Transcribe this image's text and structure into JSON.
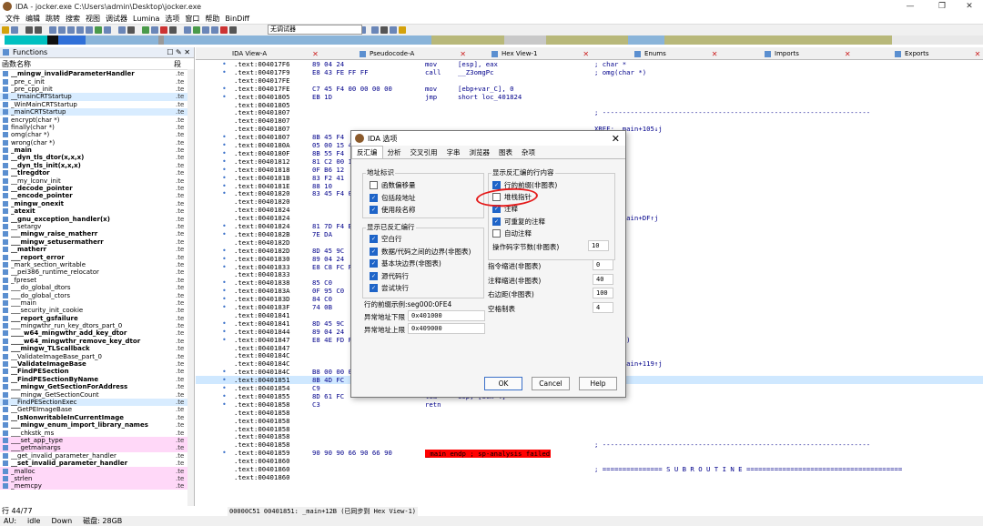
{
  "window": {
    "title": "IDA - jocker.exe C:\\Users\\admin\\Desktop\\jocker.exe",
    "controls": [
      "—",
      "❐",
      "✕"
    ]
  },
  "menu": [
    "文件",
    "编辑",
    "跳转",
    "搜索",
    "视图",
    "调试器",
    "Lumina",
    "选项",
    "窗口",
    "帮助",
    "BinDiff"
  ],
  "toolbar": {
    "debugger_select": "无调试器"
  },
  "functions_panel": {
    "title": "Functions",
    "col_name": "函数名称",
    "col_seg": "段",
    "items": [
      {
        "name": "__mingw_invalidParameterHandler",
        "seg": ".te",
        "style": "bold"
      },
      {
        "name": "_pre_c_init",
        "seg": ".te",
        "style": "normal"
      },
      {
        "name": "_pre_cpp_init",
        "seg": ".te",
        "style": "normal"
      },
      {
        "name": "__tmainCRTStartup",
        "seg": ".te",
        "style": "lib"
      },
      {
        "name": "_WinMainCRTStartup",
        "seg": ".te",
        "style": "normal"
      },
      {
        "name": "_mainCRTStartup",
        "seg": ".te",
        "style": "lib"
      },
      {
        "name": "encrypt(char *)",
        "seg": ".te",
        "style": "normal"
      },
      {
        "name": "finally(char *)",
        "seg": ".te",
        "style": "normal"
      },
      {
        "name": "omg(char *)",
        "seg": ".te",
        "style": "normal"
      },
      {
        "name": "wrong(char *)",
        "seg": ".te",
        "style": "normal"
      },
      {
        "name": "_main",
        "seg": ".te",
        "style": "bold"
      },
      {
        "name": "__dyn_tls_dtor(x,x,x)",
        "seg": ".te",
        "style": "bold"
      },
      {
        "name": "__dyn_tls_init(x,x,x)",
        "seg": ".te",
        "style": "bold"
      },
      {
        "name": "__tlregdtor",
        "seg": ".te",
        "style": "bold"
      },
      {
        "name": "__my_lconv_init",
        "seg": ".te",
        "style": "normal"
      },
      {
        "name": "__decode_pointer",
        "seg": ".te",
        "style": "bold"
      },
      {
        "name": "__encode_pointer",
        "seg": ".te",
        "style": "bold"
      },
      {
        "name": "_mingw_onexit",
        "seg": ".te",
        "style": "bold"
      },
      {
        "name": "_atexit",
        "seg": ".te",
        "style": "bold"
      },
      {
        "name": "__gnu_exception_handler(x)",
        "seg": ".te",
        "style": "bold"
      },
      {
        "name": "__setargv",
        "seg": ".te",
        "style": "normal"
      },
      {
        "name": "___mingw_raise_matherr",
        "seg": ".te",
        "style": "bold"
      },
      {
        "name": "___mingw_setusermatherr",
        "seg": ".te",
        "style": "bold"
      },
      {
        "name": "__matherr",
        "seg": ".te",
        "style": "bold"
      },
      {
        "name": "___report_error",
        "seg": ".te",
        "style": "bold"
      },
      {
        "name": "_mark_section_writable",
        "seg": ".te",
        "style": "normal"
      },
      {
        "name": "__pei386_runtime_relocator",
        "seg": ".te",
        "style": "normal"
      },
      {
        "name": "_fpreset",
        "seg": ".te",
        "style": "normal"
      },
      {
        "name": "___do_global_dtors",
        "seg": ".te",
        "style": "normal"
      },
      {
        "name": "___do_global_ctors",
        "seg": ".te",
        "style": "normal"
      },
      {
        "name": "___main",
        "seg": ".te",
        "style": "normal"
      },
      {
        "name": "___security_init_cookie",
        "seg": ".te",
        "style": "normal"
      },
      {
        "name": "___report_gsfailure",
        "seg": ".te",
        "style": "bold"
      },
      {
        "name": "___mingwthr_run_key_dtors_part_0",
        "seg": ".te",
        "style": "normal"
      },
      {
        "name": "____w64_mingwthr_add_key_dtor",
        "seg": ".te",
        "style": "bold"
      },
      {
        "name": "____w64_mingwthr_remove_key_dtor",
        "seg": ".te",
        "style": "bold"
      },
      {
        "name": "___mingw_TLScallback",
        "seg": ".te",
        "style": "bold"
      },
      {
        "name": "__ValidateImageBase_part_0",
        "seg": ".te",
        "style": "normal"
      },
      {
        "name": "__ValidateImageBase",
        "seg": ".te",
        "style": "bold"
      },
      {
        "name": "__FindPESection",
        "seg": ".te",
        "style": "bold"
      },
      {
        "name": "__FindPESectionByName",
        "seg": ".te",
        "style": "bold"
      },
      {
        "name": "___mingw_GetSectionForAddress",
        "seg": ".te",
        "style": "bold"
      },
      {
        "name": "___mingw_GetSectionCount",
        "seg": ".te",
        "style": "normal"
      },
      {
        "name": "__FindPESectionExec",
        "seg": ".te",
        "style": "lib"
      },
      {
        "name": "__GetPEImageBase",
        "seg": ".te",
        "style": "normal"
      },
      {
        "name": "__IsNonwritableInCurrentImage",
        "seg": ".te",
        "style": "bold"
      },
      {
        "name": "___mingw_enum_import_library_names",
        "seg": ".te",
        "style": "bold"
      },
      {
        "name": "___chkstk_ms",
        "seg": ".te",
        "style": "normal"
      },
      {
        "name": "___set_app_type",
        "seg": ".te",
        "style": "pink"
      },
      {
        "name": "___getmainargs",
        "seg": ".te",
        "style": "pink"
      },
      {
        "name": "__get_invalid_parameter_handler",
        "seg": ".te",
        "style": "normal"
      },
      {
        "name": "__set_invalid_parameter_handler",
        "seg": ".te",
        "style": "bold"
      },
      {
        "name": "_malloc",
        "seg": ".te",
        "style": "pink"
      },
      {
        "name": "_strlen",
        "seg": ".te",
        "style": "pink"
      },
      {
        "name": "_memcpy",
        "seg": ".te",
        "style": "pink"
      }
    ],
    "row_status": "行 44/77"
  },
  "tabs": [
    {
      "label": "IDA View-A"
    },
    {
      "label": "Pseudocode-A"
    },
    {
      "label": "Hex View-1"
    },
    {
      "label": "Enums"
    },
    {
      "label": "Imports"
    },
    {
      "label": "Exports"
    }
  ],
  "disasm": [
    {
      "dot": "•",
      "addr": ".text:004017F6",
      "bytes": "89 04 24",
      "mn": "mov",
      "op": "[esp], eax",
      "cmt": "; char *"
    },
    {
      "dot": "•",
      "addr": ".text:004017F9",
      "bytes": "E8 43 FE FF FF",
      "mn": "call",
      "op": "__Z3omgPc",
      "cmt": "; omg(char *)"
    },
    {
      "dot": "",
      "addr": ".text:004017FE",
      "bytes": "",
      "mn": "",
      "op": "",
      "cmt": ""
    },
    {
      "dot": "•",
      "addr": ".text:004017FE",
      "bytes": "C7 45 F4 00 00 00 00",
      "mn": "mov",
      "op": "[ebp+var_C], 0",
      "cmt": ""
    },
    {
      "dot": "•",
      "addr": ".text:00401805",
      "bytes": "EB 1D",
      "mn": "jmp",
      "op": "short loc_401824",
      "cmt": ""
    },
    {
      "dot": "",
      "addr": ".text:00401805",
      "bytes": "",
      "mn": "",
      "op": "",
      "cmt": ""
    },
    {
      "dot": "",
      "addr": ".text:00401807",
      "bytes": "",
      "mn": "",
      "op": "",
      "cmt": "; -------------------------------------------------------------------"
    },
    {
      "dot": "",
      "addr": ".text:00401807",
      "bytes": "",
      "mn": "",
      "op": "",
      "cmt": ""
    },
    {
      "dot": "",
      "addr": ".text:00401807",
      "bytes": "",
      "mn": "",
      "op": "",
      "cmt": "XREF: _main+105↓j"
    },
    {
      "dot": "•",
      "addr": ".text:00401807",
      "bytes": "8B 45 F4",
      "mn": "",
      "op": "",
      "cmt": ""
    },
    {
      "dot": "•",
      "addr": ".text:0040180A",
      "bytes": "05 00 15 40 00",
      "mn": "",
      "op": "",
      "cmt": "(char *)"
    },
    {
      "dot": "•",
      "addr": ".text:0040180F",
      "bytes": "8B 55 F4",
      "mn": "",
      "op": "",
      "cmt": ""
    },
    {
      "dot": "•",
      "addr": ".text:00401812",
      "bytes": "81 C2 00 15 40",
      "mn": "",
      "op": "",
      "cmt": "(char *)"
    },
    {
      "dot": "•",
      "addr": ".text:00401818",
      "bytes": "0F B6 12",
      "mn": "",
      "op": "",
      "cmt": ""
    },
    {
      "dot": "•",
      "addr": ".text:0040181B",
      "bytes": "83 F2 41",
      "mn": "",
      "op": "",
      "cmt": ""
    },
    {
      "dot": "•",
      "addr": ".text:0040181E",
      "bytes": "88 10",
      "mn": "",
      "op": "",
      "cmt": ""
    },
    {
      "dot": "•",
      "addr": ".text:00401820",
      "bytes": "83 45 F4 01",
      "mn": "",
      "op": "",
      "cmt": ""
    },
    {
      "dot": "",
      "addr": ".text:00401820",
      "bytes": "",
      "mn": "",
      "op": "",
      "cmt": ""
    },
    {
      "dot": "",
      "addr": ".text:00401824",
      "bytes": "",
      "mn": "",
      "op": "",
      "cmt": ""
    },
    {
      "dot": "",
      "addr": ".text:00401824",
      "bytes": "",
      "mn": "",
      "op": "",
      "cmt": "XREF: _main+DF↑j"
    },
    {
      "dot": "•",
      "addr": ".text:00401824",
      "bytes": "81 7D F4 BA 0",
      "mn": "",
      "op": "",
      "cmt": ""
    },
    {
      "dot": "•",
      "addr": ".text:0040182B",
      "bytes": "7E DA",
      "mn": "",
      "op": "",
      "cmt": ""
    },
    {
      "dot": "",
      "addr": ".text:0040182D",
      "bytes": "",
      "mn": "",
      "op": "",
      "cmt": ""
    },
    {
      "dot": "•",
      "addr": ".text:0040182D",
      "bytes": "8D 45 9C",
      "mn": "",
      "op": "",
      "cmt": ""
    },
    {
      "dot": "•",
      "addr": ".text:00401830",
      "bytes": "89 04 24",
      "mn": "",
      "op": "",
      "cmt": ""
    },
    {
      "dot": "•",
      "addr": ".text:00401833",
      "bytes": "E8 C8 FC FF F",
      "mn": "",
      "op": "",
      "cmt": "(char *)"
    },
    {
      "dot": "",
      "addr": ".text:00401833",
      "bytes": "",
      "mn": "",
      "op": "",
      "cmt": ""
    },
    {
      "dot": "•",
      "addr": ".text:00401838",
      "bytes": "85 C0",
      "mn": "",
      "op": "",
      "cmt": ""
    },
    {
      "dot": "•",
      "addr": ".text:0040183A",
      "bytes": "0F 95 C0",
      "mn": "",
      "op": "",
      "cmt": ""
    },
    {
      "dot": "•",
      "addr": ".text:0040183D",
      "bytes": "84 C0",
      "mn": "",
      "op": "",
      "cmt": ""
    },
    {
      "dot": "•",
      "addr": ".text:0040183F",
      "bytes": "74 0B",
      "mn": "",
      "op": "",
      "cmt": ""
    },
    {
      "dot": "",
      "addr": ".text:00401841",
      "bytes": "",
      "mn": "",
      "op": "",
      "cmt": ""
    },
    {
      "dot": "•",
      "addr": ".text:00401841",
      "bytes": "8D 45 9C",
      "mn": "",
      "op": "",
      "cmt": ""
    },
    {
      "dot": "•",
      "addr": ".text:00401844",
      "bytes": "89 04 24",
      "mn": "",
      "op": "",
      "cmt": ""
    },
    {
      "dot": "•",
      "addr": ".text:00401847",
      "bytes": "E8 4E FD FF F",
      "mn": "",
      "op": "",
      "cmt": "y(char *)"
    },
    {
      "dot": "",
      "addr": ".text:00401847",
      "bytes": "",
      "mn": "",
      "op": "",
      "cmt": ""
    },
    {
      "dot": "",
      "addr": ".text:0040184C",
      "bytes": "",
      "mn": "",
      "op": "",
      "cmt": ""
    },
    {
      "dot": "",
      "addr": ".text:0040184C",
      "bytes": "",
      "mn": "",
      "op": "",
      "cmt": "XREF: _main+119↑j"
    },
    {
      "dot": "•",
      "addr": ".text:0040184C",
      "bytes": "B8 00 00 00 00",
      "mn": "mov",
      "op": "eax, 0",
      "cmt": ""
    },
    {
      "dot": "•",
      "addr": ".text:00401851",
      "bytes": "8B 4D FC",
      "mn": "mov",
      "op": "ecx, [ebp+var_4]",
      "cmt": "",
      "hl": true
    },
    {
      "dot": "•",
      "addr": ".text:00401854",
      "bytes": "C9",
      "mn": "leave",
      "op": "",
      "cmt": ""
    },
    {
      "dot": "•",
      "addr": ".text:00401855",
      "bytes": "8D 61 FC",
      "mn": "lea",
      "op": "esp, [ecx-4]",
      "cmt": ""
    },
    {
      "dot": "•",
      "addr": ".text:00401858",
      "bytes": "C3",
      "mn": "retn",
      "op": "",
      "cmt": ""
    },
    {
      "dot": "",
      "addr": ".text:00401858",
      "bytes": "",
      "mn": "",
      "op": "",
      "cmt": ""
    },
    {
      "dot": "",
      "addr": ".text:00401858",
      "bytes": "",
      "mn": "",
      "op": "",
      "cmt": ""
    },
    {
      "dot": "",
      "addr": ".text:00401858",
      "bytes": "",
      "mn": "",
      "op": "",
      "cmt": ""
    },
    {
      "dot": "",
      "addr": ".text:00401858",
      "bytes": "",
      "mn": "",
      "op": "",
      "cmt": ""
    },
    {
      "dot": "",
      "addr": ".text:00401858",
      "bytes": "",
      "mn": "",
      "op": "",
      "cmt": "; -------------------------------------------------------------------"
    },
    {
      "dot": "•",
      "addr": ".text:00401859",
      "bytes": "90 90 90 66 90 66 90",
      "mn": "align 10h",
      "op": "",
      "cmt": ""
    },
    {
      "dot": "",
      "addr": ".text:00401860",
      "bytes": "",
      "mn": "",
      "op": "",
      "cmt": ""
    },
    {
      "dot": "",
      "addr": ".text:00401860",
      "bytes": "",
      "mn": "",
      "op": "",
      "cmt": "; =============== S U B R O U T I N E ======================================="
    },
    {
      "dot": "",
      "addr": ".text:00401860",
      "bytes": "",
      "mn": "",
      "op": "",
      "cmt": ""
    }
  ],
  "sp_error": "_main endp ; sp-analysis failed",
  "bottom_addr": "00000C51 00401851: _main+12B (已同步到 Hex View-1)",
  "statusbar": {
    "au": "AU:",
    "state": "idle",
    "dir": "Down",
    "disk": "磁盘: 28GB"
  },
  "dialog": {
    "title": "IDA 选项",
    "tabs": [
      "反汇编",
      "分析",
      "交叉引用",
      "字串",
      "浏览器",
      "图表",
      "杂项"
    ],
    "addr_group": "地址标识",
    "addr_opts": [
      {
        "label": "函数偏移量",
        "checked": false
      },
      {
        "label": "包括段地址",
        "checked": true
      },
      {
        "label": "使用段名称",
        "checked": true
      }
    ],
    "disp_group": "显示已反汇编行",
    "disp_opts": [
      {
        "label": "空白行",
        "checked": true
      },
      {
        "label": "数据/代码之间的边界(非图表)",
        "checked": true
      },
      {
        "label": "基本块边界(非图表)",
        "checked": true
      },
      {
        "label": "源代码行",
        "checked": true
      },
      {
        "label": "尝试块行",
        "checked": true
      }
    ],
    "line_prefix_label": "行的前缀示例:seg000:0FE4",
    "low_addr_label": "异常地址下限",
    "low_addr_value": "0x401000",
    "high_addr_label": "异常地址上限",
    "high_addr_value": "0x409000",
    "content_group": "显示反汇编的行内容",
    "content_opts": [
      {
        "label": "行的前缀(非图表)",
        "checked": true
      },
      {
        "label": "堆栈指针",
        "checked": false
      },
      {
        "label": "注释",
        "checked": true
      },
      {
        "label": "可重复的注释",
        "checked": true
      },
      {
        "label": "自动注释",
        "checked": false
      }
    ],
    "opcode_label": "操作码字节数(非图表)",
    "opcode_value": "10",
    "indent_label": "指令缩进(非图表)",
    "indent_value": "0",
    "comment_indent_label": "注释缩进(非图表)",
    "comment_indent_value": "40",
    "right_margin_label": "右边距(非图表)",
    "right_margin_value": "100",
    "tab_label": "空格制表",
    "tab_value": "4",
    "ok_label": "OK",
    "cancel_label": "Cancel",
    "help_label": "Help"
  }
}
